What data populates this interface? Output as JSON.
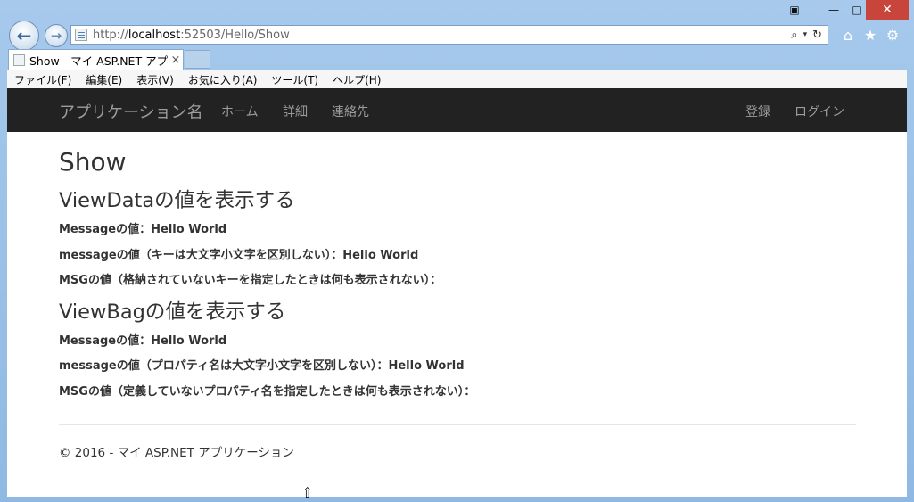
{
  "browser": {
    "url_prefix": "http://",
    "url_host": "localhost",
    "url_rest": ":52503/Hello/Show",
    "tab_title": "Show - マイ ASP.NET アプ...",
    "tab_close": "×",
    "menu": [
      "ファイル(F)",
      "編集(E)",
      "表示(V)",
      "お気に入り(A)",
      "ツール(T)",
      "ヘルプ(H)"
    ]
  },
  "site": {
    "brand": "アプリケーション名",
    "nav": [
      "ホーム",
      "詳細",
      "連絡先"
    ],
    "nav_right": [
      "登録",
      "ログイン"
    ]
  },
  "page": {
    "title": "Show",
    "viewdata": {
      "heading": "ViewDataの値を表示する",
      "lines": [
        "Messageの値：Hello World",
        "messageの値（キーは大文字小文字を区別しない）：Hello World",
        "MSGの値（格納されていないキーを指定したときは何も表示されない）："
      ]
    },
    "viewbag": {
      "heading": "ViewBagの値を表示する",
      "lines": [
        "Messageの値：Hello World",
        "messageの値（プロパティ名は大文字小文字を区別しない）：Hello World",
        "MSGの値（定義していないプロパティ名を指定したときは何も表示されない）："
      ]
    },
    "footer": "© 2016 - マイ ASP.NET アプリケーション"
  }
}
